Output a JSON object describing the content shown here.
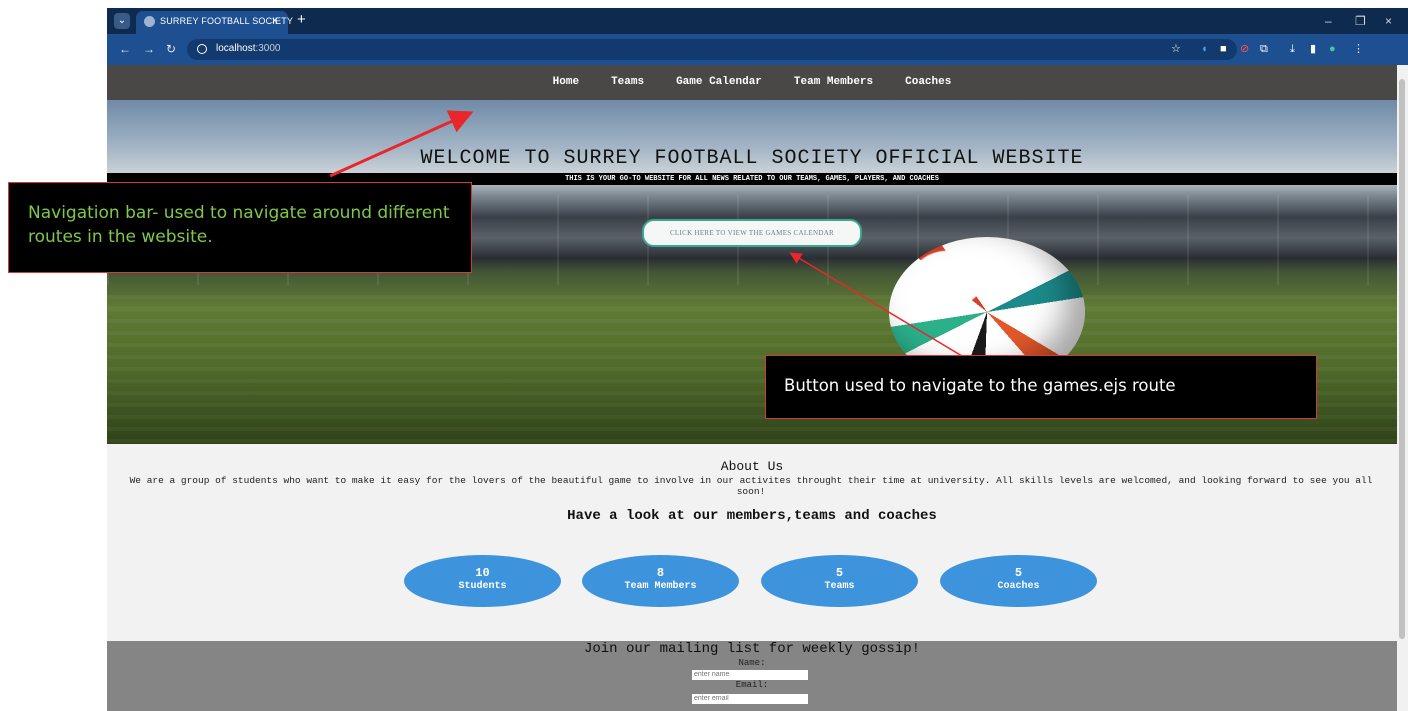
{
  "browser": {
    "tab_title": "SURREY FOOTBALL SOCIETY",
    "tab_close": "×",
    "new_tab": "+",
    "url_host": "localhost",
    "url_port": ":3000",
    "window_controls": [
      "–",
      "❐",
      "×"
    ]
  },
  "site": {
    "nav": [
      "Home",
      "Teams",
      "Game Calendar",
      "Team Members",
      "Coaches"
    ],
    "hero": {
      "title": "WELCOME TO SURREY FOOTBALL SOCIETY OFFICIAL WEBSITE",
      "subtitle": "THIS IS YOUR GO-TO WEBSITE FOR ALL NEWS RELATED TO OUR TEAMS, GAMES, PLAYERS, AND COACHES",
      "button": "CLICK HERE TO VIEW THE GAMES CALENDAR"
    },
    "about": {
      "title": "About Us",
      "text": "We are a group of students who want to make it easy for the lovers of the beautiful game to involve in our activites throught their time at university. All skills levels are welcomed, and looking forward to see you all soon!",
      "members_heading": "Have a look at our members,teams and coaches"
    },
    "stats": [
      {
        "value": "10",
        "label": "Students"
      },
      {
        "value": "8",
        "label": "Team Members"
      },
      {
        "value": "5",
        "label": "Teams"
      },
      {
        "value": "5",
        "label": "Coaches"
      }
    ],
    "mailing": {
      "title": "Join our mailing list for weekly gossip!",
      "name_label": "Name:",
      "name_placeholder": "enter name",
      "email_label": "Email:",
      "email_placeholder": "enter email"
    }
  },
  "annotations": {
    "nav_note": "Navigation bar- used to navigate around different routes in the website.",
    "button_note": "Button used to navigate to the games.ejs route",
    "arrow_color": "#e8262b",
    "nav_text_color": "#7fc84a"
  },
  "colors": {
    "tab_bar": "#0f2a4f",
    "toolbar": "#1d4f91",
    "site_nav": "#4a4747",
    "stat_bubble": "#3e94dc",
    "mailing_bg": "#858585"
  }
}
